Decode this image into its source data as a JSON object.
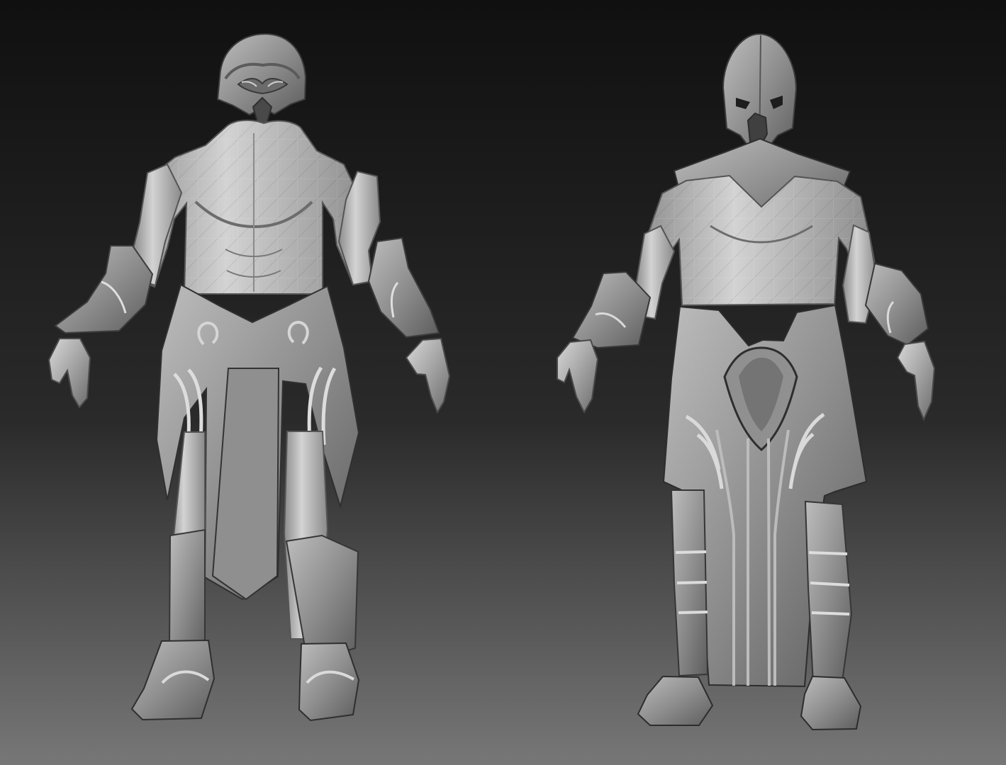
{
  "scene": {
    "viewport_background": {
      "top_color": "#101010",
      "bottom_color": "#777777"
    },
    "material_colors": {
      "base": "#a9a9a9",
      "light": "#cfcfcf",
      "mid": "#8f8f8f",
      "dark": "#5a5a5a",
      "line": "#333333"
    },
    "models": [
      {
        "name": "left-armored-warrior",
        "description_visible": false
      },
      {
        "name": "right-hooded-warrior",
        "description_visible": false
      }
    ]
  }
}
